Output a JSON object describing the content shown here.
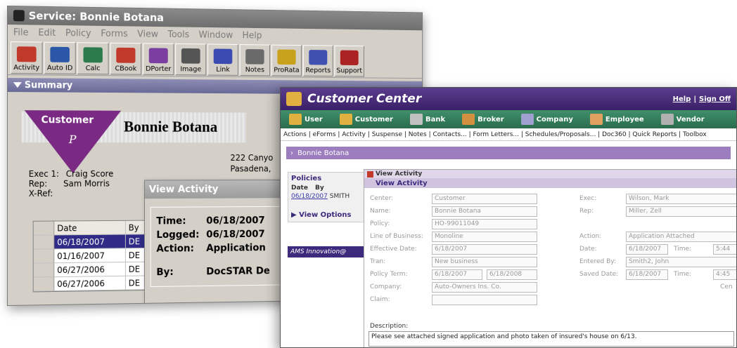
{
  "win1": {
    "title": "Service: Bonnie Botana",
    "menu": [
      "File",
      "Edit",
      "Policy",
      "Forms",
      "View",
      "Tools",
      "Window",
      "Help"
    ],
    "toolbar": [
      {
        "label": "Activity",
        "icon": "activity-icon",
        "color": "#c0392b"
      },
      {
        "label": "Auto ID",
        "icon": "car-icon",
        "color": "#2a57a8"
      },
      {
        "label": "Calc",
        "icon": "calculator-icon",
        "color": "#2b7a4b"
      },
      {
        "label": "CBook",
        "icon": "phone-icon",
        "color": "#c0392b"
      },
      {
        "label": "DPorter",
        "icon": "document-porter-icon",
        "color": "#7a3fa0"
      },
      {
        "label": "Image",
        "icon": "camera-icon",
        "color": "#555555"
      },
      {
        "label": "Link",
        "icon": "link-icon",
        "color": "#3a4ab0"
      },
      {
        "label": "Notes",
        "icon": "notes-icon",
        "color": "#6a6a6a"
      },
      {
        "label": "ProRata",
        "icon": "prorata-icon",
        "color": "#c9a21c"
      },
      {
        "label": "Reports",
        "icon": "reports-icon",
        "color": "#4050b0"
      },
      {
        "label": "Support",
        "icon": "support-icon",
        "color": "#aa2222"
      }
    ],
    "summary_label": "Summary",
    "customer_tag": "Customer",
    "customer_type": "P",
    "customer_name": "Bonnie Botana",
    "address": [
      "222 Canyo",
      "Pasadena,"
    ],
    "exec": {
      "label": "Exec 1:",
      "value": "Craig Score"
    },
    "rep": {
      "label": "Rep:",
      "value": "Sam Morris"
    },
    "xref": {
      "label": "X-Ref:",
      "value": ""
    },
    "grid": {
      "headers": [
        "Date",
        "By"
      ],
      "rows": [
        {
          "date": "06/18/2007",
          "by": "DE",
          "selected": true
        },
        {
          "date": "01/16/2007",
          "by": "DE"
        },
        {
          "date": "06/27/2006",
          "by": "DE"
        },
        {
          "date": "06/27/2006",
          "by": "DE"
        }
      ]
    },
    "view_activity": {
      "title": "View Activity",
      "time_label": "Time:",
      "time_value": "06/18/2007",
      "logged_label": "Logged:",
      "logged_value": "06/18/2007",
      "action_label": "Action:",
      "action_value": "Application",
      "by_label": "By:",
      "by_value": "DocSTAR De"
    }
  },
  "win2": {
    "title": "Customer Center",
    "help_link": "Help",
    "signoff_link": "Sign Off",
    "nav": [
      {
        "label": "User",
        "icon": "user-icon",
        "color": "#e0b040"
      },
      {
        "label": "Customer",
        "icon": "customer-icon",
        "color": "#e0b040"
      },
      {
        "label": "Bank",
        "icon": "bank-icon",
        "color": "#c0c0c0"
      },
      {
        "label": "Broker",
        "icon": "broker-icon",
        "color": "#d09040"
      },
      {
        "label": "Company",
        "icon": "company-icon",
        "color": "#a0a0d0"
      },
      {
        "label": "Employee",
        "icon": "employee-icon",
        "color": "#e0a060"
      },
      {
        "label": "Vendor",
        "icon": "vendor-icon",
        "color": "#b0b0b0"
      }
    ],
    "action_links": "Actions | eForms | Activity | Suspense | Notes | Contacts... | Form Letters... | Schedules/Proposals... | Doc360 | Quick Reports | Toolbox",
    "customer_bar": "Bonnie Botana",
    "policies": {
      "title": "Policies",
      "col_date": "Date",
      "col_by": "By",
      "row_date": "06/18/2007",
      "row_by": "SMITH",
      "view_options": "View Options"
    },
    "ams_banner": "AMS Innovation@",
    "view_activity": {
      "header": "View Activity",
      "subheader": "View Activity",
      "fields": {
        "center": {
          "label": "Center:",
          "value": "Customer"
        },
        "name": {
          "label": "Name:",
          "value": "Bonnie Botana"
        },
        "policy": {
          "label": "Policy:",
          "value": "HO-99011049"
        },
        "lob": {
          "label": "Line of Business:",
          "value": "Monoline"
        },
        "effective": {
          "label": "Effective Date:",
          "value": "6/18/2007"
        },
        "tran": {
          "label": "Tran:",
          "value": "New business"
        },
        "term": {
          "label": "Policy Term:",
          "value_from": "6/18/2007",
          "value_to": "6/18/2008"
        },
        "company": {
          "label": "Company:",
          "value": "Auto-Owners Ins. Co."
        },
        "claim": {
          "label": "Claim:",
          "value": ""
        },
        "exec": {
          "label": "Exec:",
          "value": "Wilson, Mark"
        },
        "rep": {
          "label": "Rep:",
          "value": "Miller, Zell"
        },
        "action": {
          "label": "Action:",
          "value": "Application Attached"
        },
        "date": {
          "label": "Date:",
          "value": "6/18/2007",
          "time_label": "Time:",
          "time_value": "5:44"
        },
        "entered_by": {
          "label": "Entered By:",
          "value": "Smith2, John"
        },
        "saved_date": {
          "label": "Saved Date:",
          "value": "6/18/2007",
          "time_label": "Time:",
          "time_value": "4:45"
        },
        "center_right": "Cen"
      },
      "description_label": "Description:",
      "description": "Please see attached signed application and photo taken of insured's house on 6/13."
    }
  }
}
